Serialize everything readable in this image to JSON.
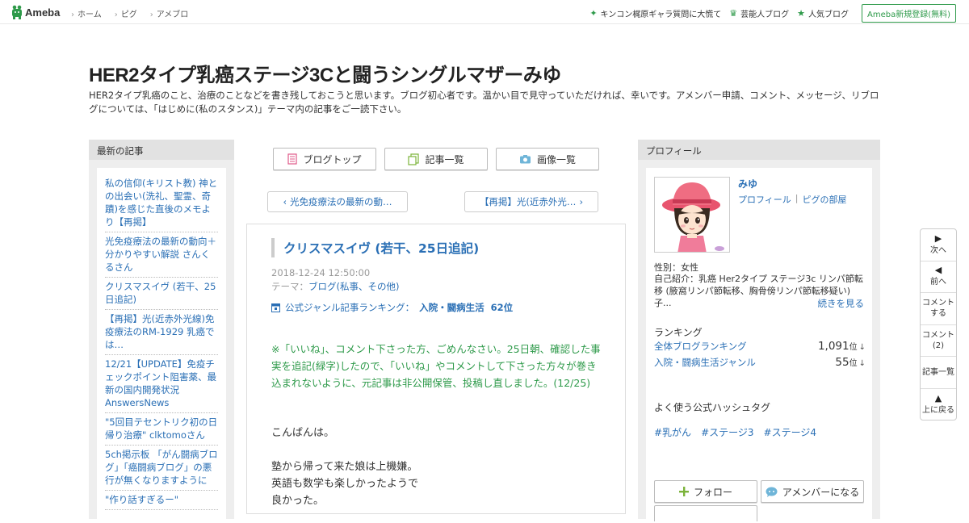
{
  "topbar": {
    "logo_text": "Ameba",
    "nav": [
      "ホーム",
      "ピグ",
      "アメブロ"
    ],
    "links": [
      "キンコン梶原ギャラ質問に大慌て",
      "芸能人ブログ",
      "人気ブログ"
    ],
    "signup": "Ameba新規登録(無料)"
  },
  "blog": {
    "title": "HER2タイプ乳癌ステージ3Cと闘うシングルマザーみゆ",
    "description": "HER2タイプ乳癌のこと、治療のことなどを書き残しておこうと思います。ブログ初心者です。温かい目で見守っていただければ、幸いです。アメンバー申請、コメント、メッセージ、リブログについては、「はじめに(私のスタンス)」テーマ内の記事をご一読下さい。"
  },
  "left_sidebar": {
    "header": "最新の記事",
    "items": [
      "私の信仰(キリスト教) 神との出会い(洗礼、聖霊、奇蹟)を感じた直後のメモより【再掲】",
      "光免疫療法の最新の動向＋分かりやすい解説 さんくるさん",
      "クリスマスイヴ (若干、25日追記)",
      "【再掲】光(近赤外光線)免疫療法のRM-1929 乳癌では…",
      "12/21【UPDATE】免疫チェックポイント阻害薬、最新の国内開発状況 AnswersNews",
      "\"5回目テセントリク初の日帰り治療\" clktomoさん",
      "5ch掲示板 「がん闘病ブログ」「癌闘病ブログ」の悪行が無くなりますように",
      "\"作り話すぎるー\""
    ]
  },
  "tabs": [
    "ブログトップ",
    "記事一覧",
    "画像一覧"
  ],
  "pager": {
    "prev": "光免疫療法の最新の動…",
    "next": "【再掲】光(近赤外光…"
  },
  "article": {
    "title": "クリスマスイヴ (若干、25日追記)",
    "date": "2018-12-24 12:50:00",
    "theme_label": "テーマ：",
    "theme": "ブログ(私事、その他)",
    "ranking_label": "公式ジャンル記事ランキング：",
    "ranking_genre": "入院・闘病生活",
    "ranking_value": "62位",
    "note": "※「いいね」、コメント下さった方、ごめんなさい。25日朝、確認した事実を追記(緑字)したので、「いいね」やコメントして下さった方々が巻き込まれないように、元記事は非公開保管、投稿し直しました。(12/25)",
    "greeting": "こんばんは。",
    "para_lines": [
      "塾から帰って来た娘は上機嫌。",
      "英語も数学も楽しかったようで",
      "良かった。"
    ]
  },
  "profile": {
    "header": "プロフィール",
    "name": "みゆ",
    "link_profile": "プロフィール",
    "link_room": "ピグの部屋",
    "link_sep": "|",
    "gender": "性別：女性",
    "intro": "自己紹介：乳癌 Her2タイプ ステージ3c リンパ節転移 (腋窩リンパ節転移、胸骨傍リンパ節転移疑い) 子...",
    "read_more": "続きを見る",
    "ranking_header": "ランキング",
    "rankings": [
      {
        "label": "全体ブログランキング",
        "value": "1,091",
        "unit": "位",
        "arrow": "↓"
      },
      {
        "label": "入院・闘病生活ジャンル",
        "value": "55",
        "unit": "位",
        "arrow": "↓"
      }
    ],
    "hashtag_header": "よく使う公式ハッシュタグ",
    "hashtags": [
      "#乳がん",
      "#ステージ3",
      "#ステージ4"
    ],
    "follow": "フォロー",
    "member": "アメンバーになる"
  },
  "floatnav": {
    "next": "次へ",
    "prev": "前へ",
    "comment_do_1": "コメント",
    "comment_do_2": "する",
    "comment_count_1": "コメント",
    "comment_count_2": "(2)",
    "list": "記事一覧",
    "top": "上に戻る"
  },
  "colors": {
    "accent_green": "#2e9a4a",
    "link_blue": "#2a6fb5"
  }
}
